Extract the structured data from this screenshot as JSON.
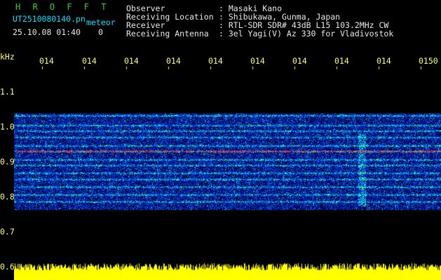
{
  "header": {
    "app_title": "H R O F F T",
    "filename": "UT2510080140.pn",
    "file_type": "meteor",
    "timestamp": "25.10.08 01:40",
    "counter": "0"
  },
  "info": [
    {
      "label": "Observer",
      "value": ": Masaki Kano"
    },
    {
      "label": "Receiving Location",
      "value": ": Shibukawa, Gunma, Japan"
    },
    {
      "label": "Receiver",
      "value": ": RTL-SDR SDR# 43dB L15 103.2MHz CW"
    },
    {
      "label": "Receiving Antenna",
      "value": ": 3el Yagi(V) Az 330 for Vladivostok"
    }
  ],
  "axis": {
    "y_unit": "kHz",
    "y_ticks": [
      "1.1",
      "1.0",
      "0.9",
      "0.8",
      "0.7",
      "0.6"
    ],
    "x_ticks": [
      "014",
      "014",
      "014",
      "014",
      "014",
      "014",
      "014",
      "014",
      "014",
      "0150"
    ]
  },
  "colors": {
    "background": "#000000",
    "label_yellow": "#ffff66",
    "title_green": "#28d828",
    "header_cyan": "#00e0ff",
    "amplitude_yellow": "#ffff00"
  }
}
